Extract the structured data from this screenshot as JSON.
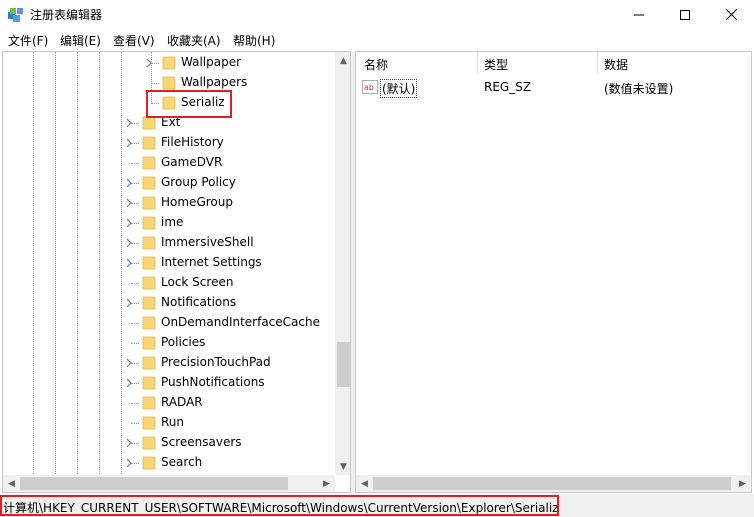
{
  "window": {
    "title": "注册表编辑器"
  },
  "menu": [
    "文件(F)",
    "编辑(E)",
    "查看(V)",
    "收藏夹(A)",
    "帮助(H)"
  ],
  "tree": {
    "items": [
      {
        "label": "Wallpaper",
        "expander": true,
        "level": 2
      },
      {
        "label": "Wallpapers",
        "expander": false,
        "level": 2
      },
      {
        "label": "Serializ",
        "expander": false,
        "level": 2,
        "selected": true
      },
      {
        "label": "Ext",
        "expander": true,
        "level": 1
      },
      {
        "label": "FileHistory",
        "expander": true,
        "level": 1
      },
      {
        "label": "GameDVR",
        "expander": false,
        "level": 1
      },
      {
        "label": "Group Policy",
        "expander": true,
        "level": 1
      },
      {
        "label": "HomeGroup",
        "expander": true,
        "level": 1
      },
      {
        "label": "ime",
        "expander": true,
        "level": 1
      },
      {
        "label": "ImmersiveShell",
        "expander": true,
        "level": 1
      },
      {
        "label": "Internet Settings",
        "expander": true,
        "level": 1
      },
      {
        "label": "Lock Screen",
        "expander": false,
        "level": 1
      },
      {
        "label": "Notifications",
        "expander": true,
        "level": 1
      },
      {
        "label": "OnDemandInterfaceCache",
        "expander": false,
        "level": 1
      },
      {
        "label": "Policies",
        "expander": false,
        "level": 1
      },
      {
        "label": "PrecisionTouchPad",
        "expander": true,
        "level": 1
      },
      {
        "label": "PushNotifications",
        "expander": true,
        "level": 1
      },
      {
        "label": "RADAR",
        "expander": false,
        "level": 1
      },
      {
        "label": "Run",
        "expander": false,
        "level": 1
      },
      {
        "label": "Screensavers",
        "expander": true,
        "level": 1
      },
      {
        "label": "Search",
        "expander": true,
        "level": 1
      }
    ]
  },
  "list": {
    "columns": [
      "名称",
      "类型",
      "数据"
    ],
    "rows": [
      {
        "name": "(默认)",
        "type": "REG_SZ",
        "data": "(数值未设置)",
        "icon": "string-value-icon"
      }
    ]
  },
  "status": {
    "path": "计算机\\HKEY_CURRENT_USER\\SOFTWARE\\Microsoft\\Windows\\CurrentVersion\\Explorer\\Serializ"
  },
  "colors": {
    "highlight": "#e02020",
    "folder": "#f8d775",
    "folder_dark": "#e8b84a"
  }
}
